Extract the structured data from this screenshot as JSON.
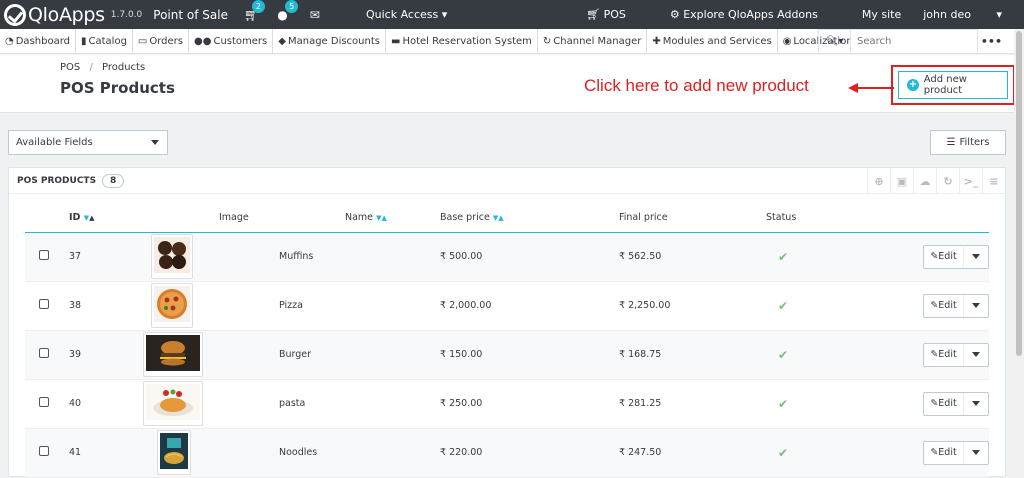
{
  "topbar": {
    "logo_text": "QloApps",
    "version": "1.7.0.0",
    "title": "Point of Sale",
    "cart_badge": "2",
    "user_badge": "5",
    "quick_access": "Quick Access",
    "pos_link": "POS",
    "explore_link": "Explore QloApps Addons",
    "mysite_link": "My site",
    "user_name": "john deo"
  },
  "tabs": [
    {
      "label": "Dashboard",
      "icon": "dashboard-icon"
    },
    {
      "label": "Catalog",
      "icon": "book-icon"
    },
    {
      "label": "Orders",
      "icon": "card-icon"
    },
    {
      "label": "Customers",
      "icon": "users-icon"
    },
    {
      "label": "Manage Discounts",
      "icon": "tag-icon"
    },
    {
      "label": "Hotel Reservation System",
      "icon": "bed-icon"
    },
    {
      "label": "Channel Manager",
      "icon": "refresh-icon"
    },
    {
      "label": "Modules and Services",
      "icon": "puzzle-icon"
    },
    {
      "label": "Localization",
      "icon": "globe-icon"
    }
  ],
  "search": {
    "placeholder": "Search"
  },
  "breadcrumb": {
    "root": "POS",
    "sep": "/",
    "current": "Products"
  },
  "page_title": "POS Products",
  "annotation": "Click here to add new product",
  "add_button": "Add new product",
  "available_fields": "Available Fields",
  "filters": "Filters",
  "panel": {
    "title": "POS PRODUCTS",
    "count": "8"
  },
  "columns": {
    "id": "ID",
    "image": "Image",
    "name": "Name",
    "base_price": "Base price",
    "final_price": "Final price",
    "status": "Status"
  },
  "edit_label": "Edit",
  "rows": [
    {
      "id": "37",
      "name": "Muffins",
      "base": "₹ 500.00",
      "final": "₹ 562.50"
    },
    {
      "id": "38",
      "name": "Pizza",
      "base": "₹ 2,000.00",
      "final": "₹ 2,250.00"
    },
    {
      "id": "39",
      "name": "Burger",
      "base": "₹ 150.00",
      "final": "₹ 168.75"
    },
    {
      "id": "40",
      "name": "pasta",
      "base": "₹ 250.00",
      "final": "₹ 281.25"
    },
    {
      "id": "41",
      "name": "Noodles",
      "base": "₹ 220.00",
      "final": "₹ 247.50"
    }
  ],
  "colors": {
    "accent": "#25b9d7",
    "topbar": "#363a41",
    "annotation": "#e02020",
    "status_ok": "#72c279"
  }
}
